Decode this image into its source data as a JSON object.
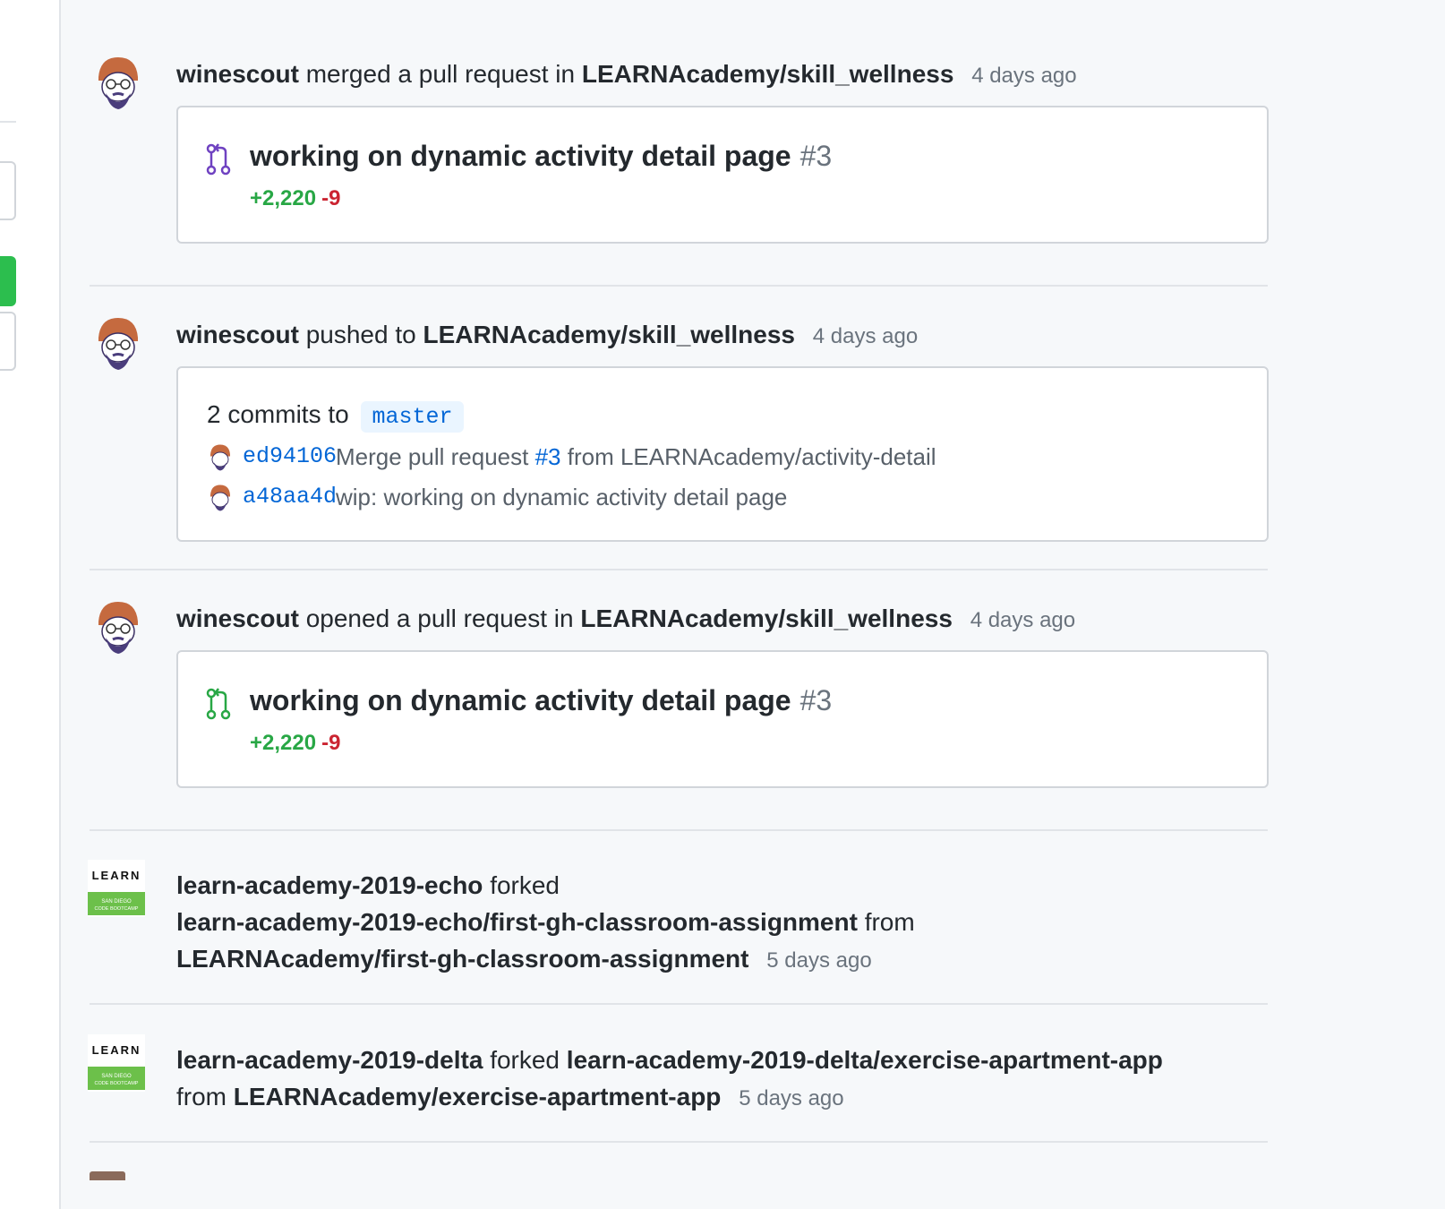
{
  "colors": {
    "addition": "#28a745",
    "deletion": "#cb2431",
    "link": "#0366d6",
    "merged_icon": "#6f42c1",
    "open_icon": "#28a745"
  },
  "events": [
    {
      "actor": "winescout",
      "action": "merged a pull request in",
      "repo": "LEARNAcademy/skill_wellness",
      "time": "4 days ago",
      "pr_icon": "git-pull-request-merged-icon",
      "pr": {
        "title": "working on dynamic activity detail page",
        "number": "#3",
        "additions": "+2,220",
        "deletions": "-9"
      }
    },
    {
      "actor": "winescout",
      "action": "pushed to",
      "repo": "LEARNAcademy/skill_wellness",
      "time": "4 days ago",
      "push": {
        "summary": "2 commits to",
        "branch": "master",
        "commits": [
          {
            "sha": "ed94106",
            "message_prefix": "Merge pull request",
            "ref": "#3",
            "message_suffix": "from LEARNAcademy/activity-detail"
          },
          {
            "sha": "a48aa4d",
            "message": "wip: working on dynamic activity detail page"
          }
        ]
      }
    },
    {
      "actor": "winescout",
      "action": "opened a pull request in",
      "repo": "LEARNAcademy/skill_wellness",
      "time": "4 days ago",
      "pr_icon": "git-pull-request-icon",
      "pr": {
        "title": "working on dynamic activity detail page",
        "number": "#3",
        "additions": "+2,220",
        "deletions": "-9"
      }
    },
    {
      "actor": "learn-academy-2019-echo",
      "action": "forked",
      "target": "learn-academy-2019-echo/first-gh-classroom-assignment",
      "from_label": "from",
      "source": "LEARNAcademy/first-gh-classroom-assignment",
      "time": "5 days ago"
    },
    {
      "actor": "learn-academy-2019-delta",
      "action": "forked",
      "target": "learn-academy-2019-delta/exercise-apartment-app",
      "from_label": "from",
      "source": "LEARNAcademy/exercise-apartment-app",
      "time": "5 days ago"
    }
  ],
  "org_logo": {
    "wordmark": "LEARN",
    "line1": "SAN DIEGO",
    "line2": "CODE BOOTCAMP"
  }
}
